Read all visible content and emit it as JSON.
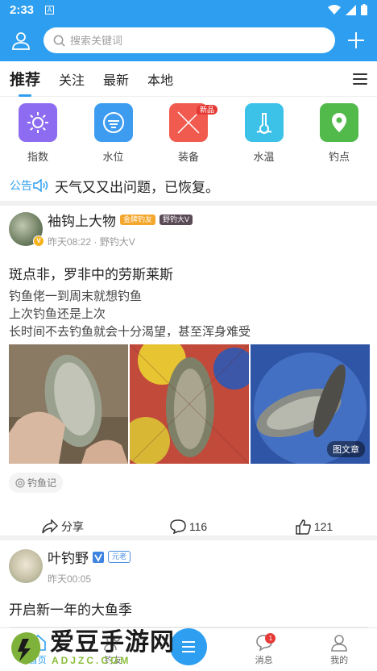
{
  "status": {
    "time": "2:33",
    "sim_icon": "A"
  },
  "search": {
    "placeholder": "搜索关键词"
  },
  "tabs": [
    {
      "label": "推荐",
      "active": true
    },
    {
      "label": "关注"
    },
    {
      "label": "最新"
    },
    {
      "label": "本地"
    }
  ],
  "shortcuts": [
    {
      "label": "指数",
      "icon": "sun-icon",
      "color": "#8d6cf1"
    },
    {
      "label": "水位",
      "icon": "water-level-icon",
      "color": "#3d9cf0"
    },
    {
      "label": "装备",
      "icon": "gear-cross-icon",
      "color": "#f15b4f",
      "tag": "新品"
    },
    {
      "label": "水温",
      "icon": "thermometer-icon",
      "color": "#3cc1e8"
    },
    {
      "label": "钓点",
      "icon": "map-pin-icon",
      "color": "#52b94b"
    }
  ],
  "notice": {
    "label": "公告",
    "text": "天气又又出问题，已恢复。"
  },
  "posts": [
    {
      "name": "袖钩上大物",
      "badges": [
        {
          "text": "金牌钓友",
          "color": "#f4a62a"
        },
        {
          "text": "野钓大V",
          "color": "#5a4a55"
        }
      ],
      "meta": "昨天08:22 · 野钓大V",
      "title": "斑点非，罗非中的劳斯莱斯",
      "lines": [
        "钓鱼佬一到周末就想钓鱼",
        "上次钓鱼还是上次",
        "长时间不去钓鱼就会十分渴望，甚至浑身难受"
      ],
      "image_caption": "图文章",
      "topic": "钓鱼记",
      "share": "分享",
      "comments": "116",
      "likes": "121"
    },
    {
      "name": "叶钓野",
      "badges": [
        {
          "text": "元老",
          "color": "#4a8fe0"
        }
      ],
      "meta": "昨天00:05",
      "title": "开启新一年的大鱼季"
    }
  ],
  "bottom_nav": [
    {
      "label": "首页",
      "active": true
    },
    {
      "label": "钓友"
    },
    {
      "label": ""
    },
    {
      "label": "消息",
      "badge": "1"
    },
    {
      "label": "我的"
    }
  ],
  "watermark": {
    "title": "爱豆手游网",
    "url": "ADJZC.COM"
  }
}
